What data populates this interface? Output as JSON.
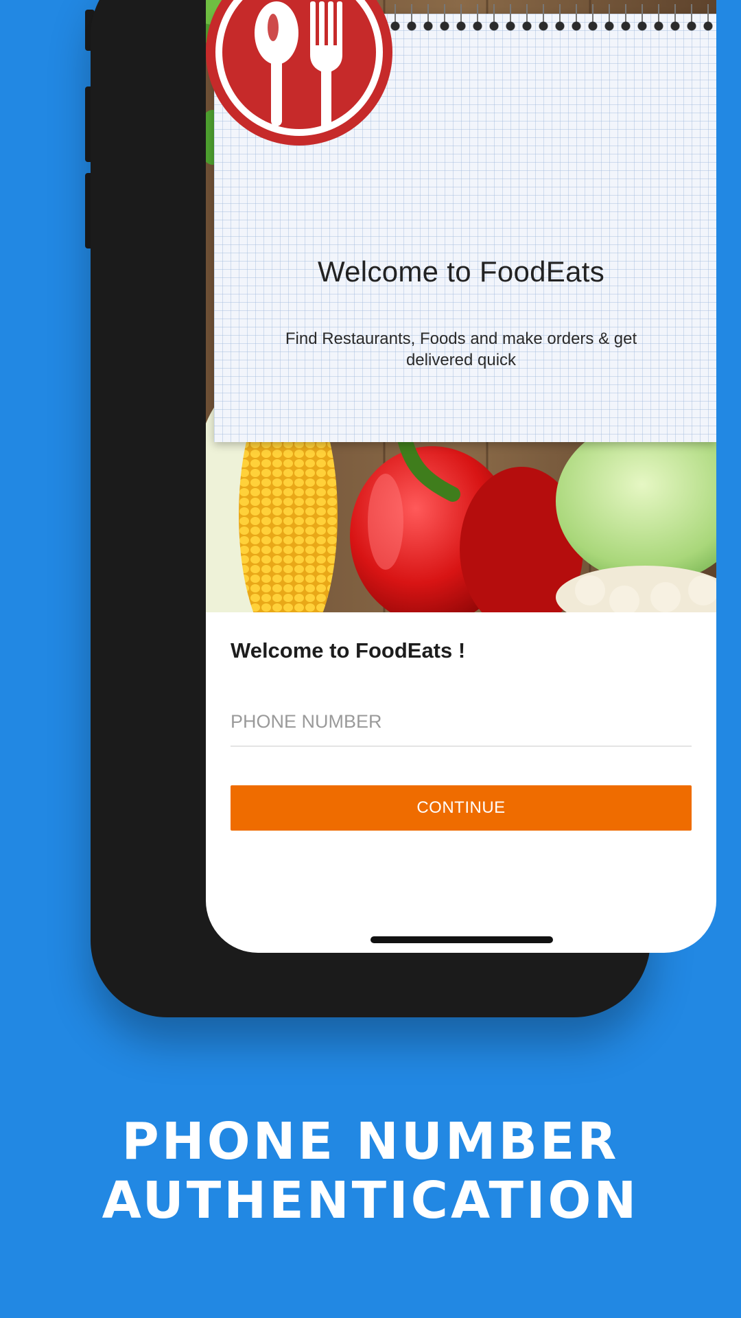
{
  "hero": {
    "title": "Welcome to FoodEats",
    "subtitle": "Find Restaurants, Foods and make orders & get delivered quick"
  },
  "form": {
    "title": "Welcome to FoodEats !",
    "phone_placeholder": "PHONE NUMBER",
    "phone_value": "",
    "continue_label": "CONTINUE"
  },
  "caption": {
    "line1": "PHONE NUMBER",
    "line2": "AUTHENTICATION"
  },
  "colors": {
    "background": "#2288e3",
    "accent_button": "#ef6c00",
    "logo_red": "#c62a2a",
    "phone_frame": "#1b1b1b"
  },
  "icons": {
    "logo": "spoon-fork-icon"
  }
}
